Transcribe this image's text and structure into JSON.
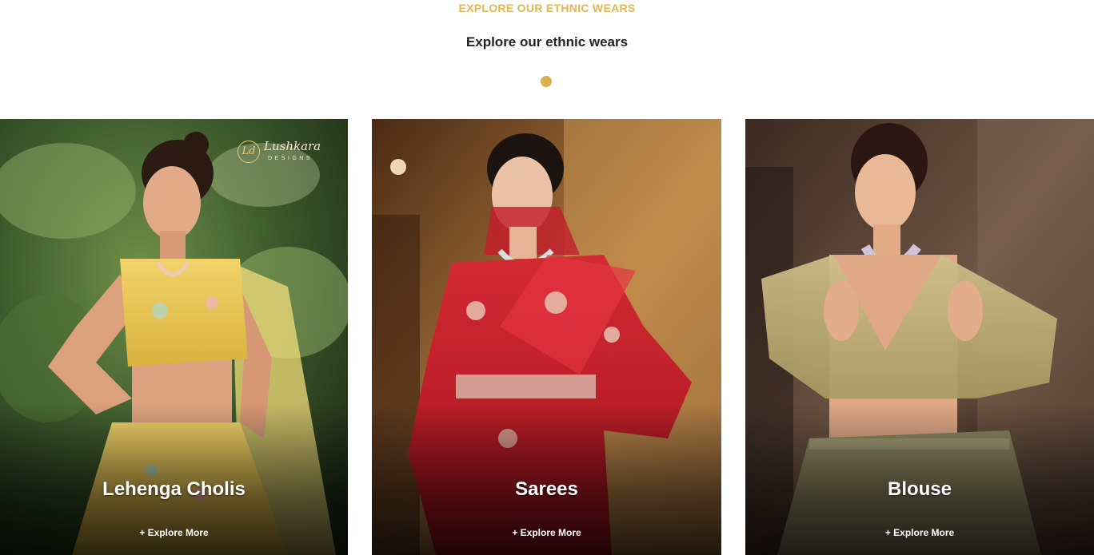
{
  "section": {
    "eyebrow": "EXPLORE OUR ETHNIC WEARS",
    "heading": "Explore our ethnic wears"
  },
  "colors": {
    "accent": "#e0b653",
    "dot": "#dbb04e",
    "heading": "#222222"
  },
  "cards": [
    {
      "title": "Lehenga Cholis",
      "link": "+ Explore More",
      "logo": {
        "mark": "Ld",
        "name": "Lushkara",
        "sub": "DESIGNS"
      }
    },
    {
      "title": "Sarees",
      "link": "+ Explore More"
    },
    {
      "title": "Blouse",
      "link": "+ Explore More"
    }
  ]
}
